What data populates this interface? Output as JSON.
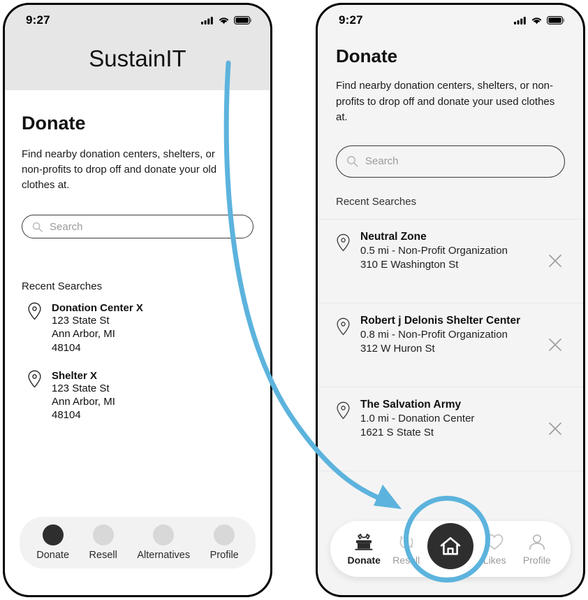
{
  "colors": {
    "accent_blue": "#5cb3dd",
    "active_dark": "#2e2e2e",
    "inactive_gray": "#d8d8d8",
    "left_header_bg": "#e6e6e6",
    "right_screen_bg": "#f4f4f4"
  },
  "status_bar": {
    "time": "9:27",
    "signal_icon": "cellular-signal-icon",
    "wifi_icon": "wifi-icon",
    "battery_icon": "battery-full-icon"
  },
  "left_phone": {
    "app_title": "SustainIT",
    "page_title": "Donate",
    "description": "Find nearby donation centers, shelters, or non-profits to drop off and donate your old clothes at.",
    "search": {
      "placeholder": "Search",
      "value": "",
      "icon": "search-icon"
    },
    "recent_label": "Recent Searches",
    "recent_searches": [
      {
        "name": "Donation Center X",
        "line1": "123 State St",
        "line2": "Ann Arbor, MI",
        "line3": "48104",
        "icon": "map-pin-icon"
      },
      {
        "name": "Shelter X",
        "line1": "123 State St",
        "line2": "Ann Arbor, MI",
        "line3": "48104",
        "icon": "map-pin-icon"
      }
    ],
    "nav": [
      {
        "label": "Donate",
        "icon": "dot-icon",
        "active": true
      },
      {
        "label": "Resell",
        "icon": "dot-icon",
        "active": false
      },
      {
        "label": "Alternatives",
        "icon": "dot-icon",
        "active": false
      },
      {
        "label": "Profile",
        "icon": "dot-icon",
        "active": false
      }
    ]
  },
  "right_phone": {
    "page_title": "Donate",
    "description": "Find nearby donation centers, shelters, or non-profits to drop off and donate your used clothes at.",
    "search": {
      "placeholder": "Search",
      "value": "",
      "icon": "search-icon"
    },
    "recent_label": "Recent Searches",
    "results": [
      {
        "name": "Neutral Zone",
        "meta": "0.5 mi - Non-Profit Organization",
        "address": "310 E Washington St",
        "pin_icon": "map-pin-icon",
        "remove_icon": "close-x-icon"
      },
      {
        "name": "Robert j Delonis Shelter Center",
        "meta": "0.8 mi - Non-Profit Organization",
        "address": "312 W Huron St",
        "pin_icon": "map-pin-icon",
        "remove_icon": "close-x-icon"
      },
      {
        "name": "The Salvation Army",
        "meta": "1.0 mi - Donation Center",
        "address": "1621 S State St",
        "pin_icon": "map-pin-icon",
        "remove_icon": "close-x-icon"
      }
    ],
    "nav": [
      {
        "label": "Donate",
        "icon": "clothes-donation-box-icon",
        "active": true
      },
      {
        "label": "Resell",
        "icon": "recycle-dollar-icon",
        "active": false
      },
      {
        "label": "",
        "icon": "home-icon",
        "active": false
      },
      {
        "label": "Likes",
        "icon": "heart-icon",
        "active": false
      },
      {
        "label": "Profile",
        "icon": "person-icon",
        "active": false
      }
    ]
  },
  "annotation": {
    "arrow_icon": "curved-arrow-icon",
    "highlight_icon": "highlight-circle-icon",
    "color": "#5cb3dd"
  }
}
